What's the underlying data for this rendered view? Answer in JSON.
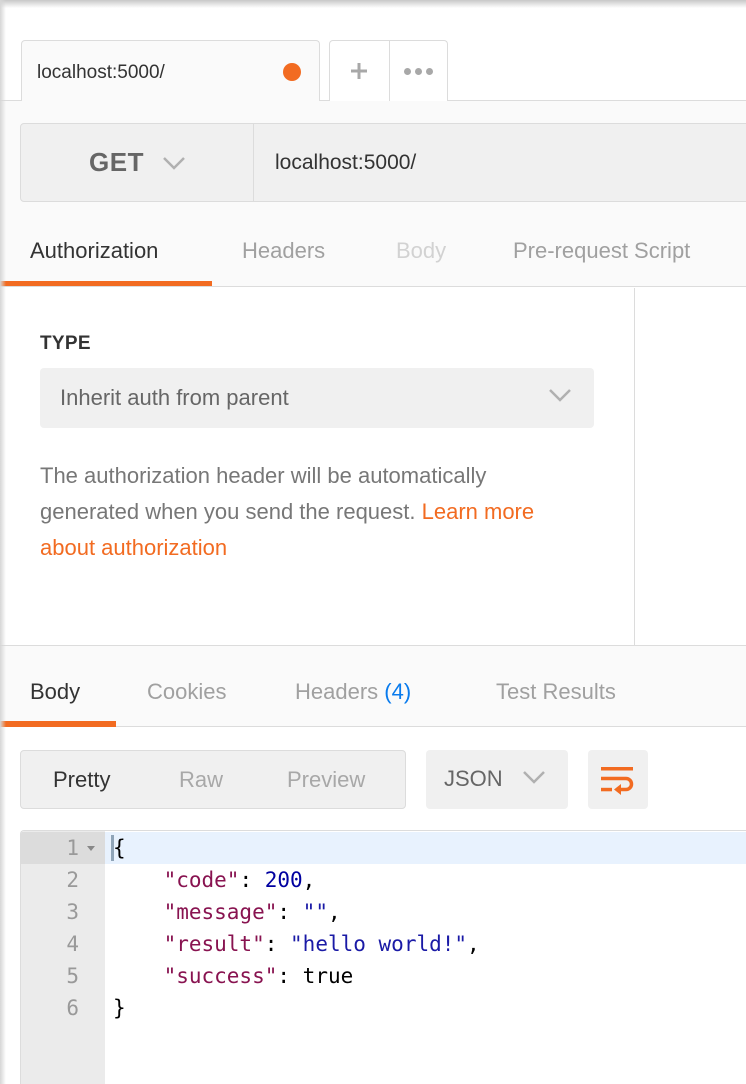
{
  "tabbar": {
    "active_tab": {
      "label": "localhost:5000/",
      "unsaved_indicator_color": "#f26b21"
    },
    "new_tab_icon": "plus-icon",
    "more_tabs_icon": "ellipsis-icon"
  },
  "request": {
    "method": "GET",
    "url": "localhost:5000/",
    "tabs": [
      {
        "label": "Authorization",
        "state": "active"
      },
      {
        "label": "Headers",
        "state": "normal"
      },
      {
        "label": "Body",
        "state": "disabled"
      },
      {
        "label": "Pre-request Script",
        "state": "normal"
      }
    ]
  },
  "auth": {
    "type_label": "TYPE",
    "type_value": "Inherit auth from parent",
    "description": "The authorization header will be automatically generated when you send the request. ",
    "link_text": "Learn more about authorization"
  },
  "response": {
    "tabs": [
      {
        "label": "Body",
        "state": "active"
      },
      {
        "label": "Cookies",
        "state": "normal"
      },
      {
        "label": "Headers",
        "count": "(4)",
        "state": "normal"
      },
      {
        "label": "Test Results",
        "state": "normal"
      }
    ],
    "view_modes": [
      {
        "label": "Pretty",
        "active": true
      },
      {
        "label": "Raw",
        "active": false
      },
      {
        "label": "Preview",
        "active": false
      }
    ],
    "format": "JSON",
    "wrap_icon": "wrap-lines-icon",
    "lines": [
      {
        "n": "1",
        "text": "{"
      },
      {
        "n": "2",
        "key": "\"code\"",
        "value": "200",
        "value_type": "number",
        "trail": ","
      },
      {
        "n": "3",
        "key": "\"message\"",
        "value": "\"\"",
        "value_type": "string",
        "trail": ","
      },
      {
        "n": "4",
        "key": "\"result\"",
        "value": "\"hello world!\"",
        "value_type": "string",
        "trail": ","
      },
      {
        "n": "5",
        "key": "\"success\"",
        "value": "true",
        "value_type": "boolean",
        "trail": ""
      },
      {
        "n": "6",
        "text": "}"
      }
    ]
  },
  "colors": {
    "accent": "#f26b21",
    "link_blue": "#097bed",
    "json_key": "#881350",
    "json_number": "#0000a0",
    "json_string": "#1a1aa6"
  }
}
